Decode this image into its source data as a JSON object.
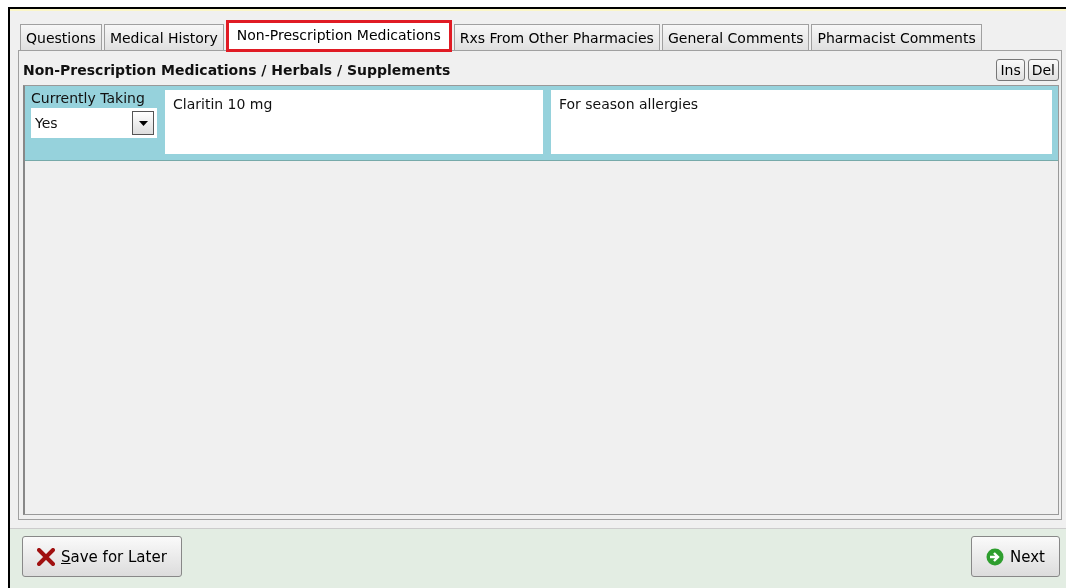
{
  "tabs": [
    {
      "label": "Questions",
      "selected": false
    },
    {
      "label": "Medical History",
      "selected": false
    },
    {
      "label": "Non-Prescription Medications",
      "selected": true
    },
    {
      "label": "Rxs From Other Pharmacies",
      "selected": false
    },
    {
      "label": "General Comments",
      "selected": false
    },
    {
      "label": "Pharmacist Comments",
      "selected": false
    }
  ],
  "section_title": "Non-Prescription Medications / Herbals / Supplements",
  "toolbar_buttons": [
    "Ins",
    "Del"
  ],
  "entries": [
    {
      "currently_taking_label": "Currently Taking",
      "currently_taking_value": "Yes",
      "medication": "Claritin 10 mg",
      "reason": "For season allergies"
    }
  ],
  "footer": {
    "save_button": "Save for Later",
    "next_button": "Next"
  }
}
